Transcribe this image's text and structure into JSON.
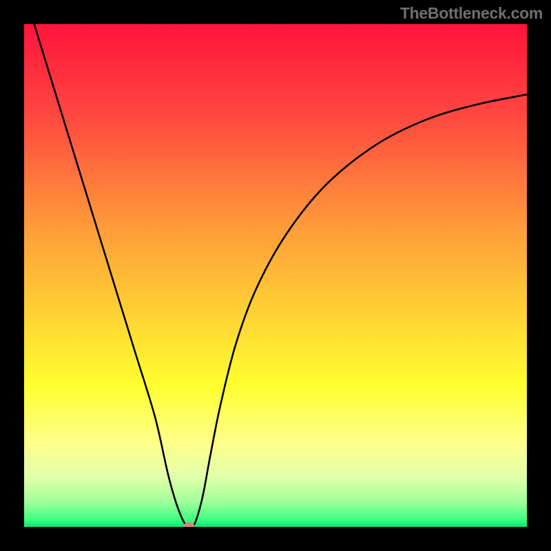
{
  "watermark": "TheBottleneck.com",
  "chart_data": {
    "type": "line",
    "title": "",
    "xlabel": "",
    "ylabel": "",
    "xlim": [
      0,
      1
    ],
    "ylim": [
      0,
      1
    ],
    "gradient_stops": [
      {
        "offset": 0.0,
        "color": "#ff143c"
      },
      {
        "offset": 0.18,
        "color": "#ff4740"
      },
      {
        "offset": 0.4,
        "color": "#ff9a3a"
      },
      {
        "offset": 0.58,
        "color": "#ffd334"
      },
      {
        "offset": 0.72,
        "color": "#ffff30"
      },
      {
        "offset": 0.83,
        "color": "#ffff8a"
      },
      {
        "offset": 0.9,
        "color": "#e3ffaa"
      },
      {
        "offset": 0.95,
        "color": "#a0ff9a"
      },
      {
        "offset": 0.985,
        "color": "#40ff80"
      },
      {
        "offset": 1.0,
        "color": "#00e878"
      }
    ],
    "series": [
      {
        "name": "bottleneck-curve",
        "x": [
          0.02,
          0.06,
          0.1,
          0.14,
          0.18,
          0.22,
          0.26,
          0.285,
          0.3,
          0.315,
          0.325,
          0.33,
          0.34,
          0.355,
          0.37,
          0.39,
          0.42,
          0.46,
          0.52,
          0.6,
          0.7,
          0.8,
          0.9,
          1.0
        ],
        "y": [
          1.0,
          0.87,
          0.74,
          0.61,
          0.48,
          0.35,
          0.22,
          0.11,
          0.055,
          0.015,
          0.0,
          0.0,
          0.008,
          0.06,
          0.14,
          0.24,
          0.36,
          0.47,
          0.58,
          0.68,
          0.76,
          0.81,
          0.84,
          0.86
        ]
      }
    ],
    "bottom_marker": {
      "x": 0.328,
      "y": 0.002,
      "rx": 0.011,
      "ry": 0.007,
      "color": "#d5866f"
    }
  }
}
